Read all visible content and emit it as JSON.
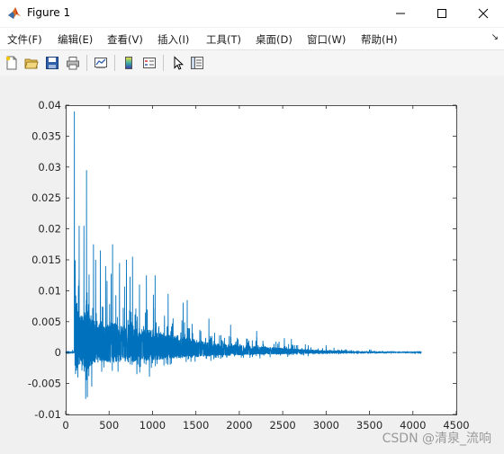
{
  "window": {
    "title": "Figure 1"
  },
  "menu": [
    {
      "label": "文件(F)"
    },
    {
      "label": "编辑(E)"
    },
    {
      "label": "查看(V)"
    },
    {
      "label": "插入(I)"
    },
    {
      "label": "工具(T)"
    },
    {
      "label": "桌面(D)"
    },
    {
      "label": "窗口(W)"
    },
    {
      "label": "帮助(H)"
    }
  ],
  "toolbar": {
    "icons": [
      "new-figure-icon",
      "open-file-icon",
      "save-icon",
      "print-icon",
      "link-plot-icon",
      "colorbar-icon",
      "legend-icon",
      "pointer-icon",
      "property-inspector-icon"
    ]
  },
  "colors": {
    "line": "#0072bd",
    "axes_bg": "#ffffff",
    "figure_bg": "#f0f0f0"
  },
  "watermark": "CSDN @清泉_流响",
  "chart_data": {
    "type": "line",
    "title": "",
    "xlabel": "",
    "ylabel": "",
    "xlim": [
      0,
      4500
    ],
    "ylim": [
      -0.01,
      0.04
    ],
    "xticks": [
      "0",
      "500",
      "1000",
      "1500",
      "2000",
      "2500",
      "3000",
      "3500",
      "4000",
      "4500"
    ],
    "yticks": [
      "-0.01",
      "-0.005",
      "0",
      "0.005",
      "0.01",
      "0.015",
      "0.02",
      "0.025",
      "0.03",
      "0.035",
      "0.04"
    ],
    "grid": false,
    "series": [
      {
        "color": "#0072bd",
        "n_points": 4096,
        "peaks": [
          {
            "x": 100,
            "y": 0.039
          },
          {
            "x": 155,
            "y": 0.0205
          },
          {
            "x": 210,
            "y": 0.0205
          },
          {
            "x": 240,
            "y": 0.0295
          },
          {
            "x": 320,
            "y": 0.0175
          },
          {
            "x": 345,
            "y": 0.015
          },
          {
            "x": 400,
            "y": 0.0165
          },
          {
            "x": 460,
            "y": 0.014
          },
          {
            "x": 540,
            "y": 0.0175
          },
          {
            "x": 620,
            "y": 0.0145
          },
          {
            "x": 700,
            "y": 0.015
          },
          {
            "x": 770,
            "y": 0.0155
          },
          {
            "x": 850,
            "y": 0.011
          },
          {
            "x": 930,
            "y": 0.0125
          },
          {
            "x": 1030,
            "y": 0.0125
          },
          {
            "x": 1180,
            "y": 0.0095
          },
          {
            "x": 1400,
            "y": 0.0085
          },
          {
            "x": 1650,
            "y": 0.0055
          },
          {
            "x": 1900,
            "y": 0.0045
          },
          {
            "x": 2200,
            "y": 0.0035
          },
          {
            "x": 2600,
            "y": 0.0022
          },
          {
            "x": 3000,
            "y": 0.0012
          },
          {
            "x": 3500,
            "y": 0.0005
          },
          {
            "x": 4096,
            "y": 0.0002
          }
        ],
        "troughs": [
          {
            "x": 230,
            "y": -0.0075
          },
          {
            "x": 250,
            "y": -0.0072
          },
          {
            "x": 140,
            "y": -0.004
          },
          {
            "x": 300,
            "y": -0.0055
          }
        ]
      }
    ]
  }
}
